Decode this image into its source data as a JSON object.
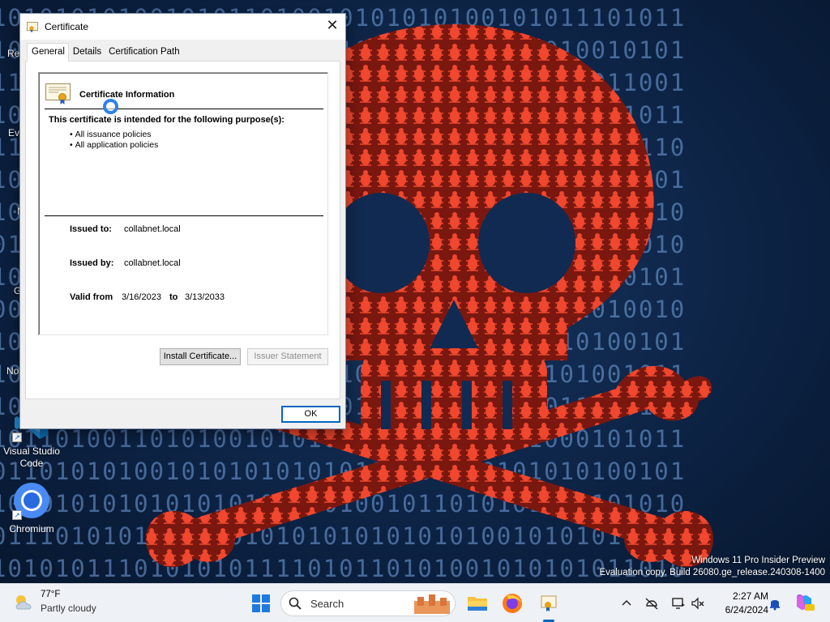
{
  "desktop": {
    "icons": [
      {
        "label": "Visual Studio\nCode"
      },
      {
        "label": "Chromium"
      }
    ],
    "partial_labels": [
      "Re",
      "Ev",
      "N",
      "G",
      "No"
    ],
    "watermark": {
      "line1": "Windows 11 Pro Insider Preview",
      "line2": "Evaluation copy. Build 26080.ge_release.240308-1400"
    }
  },
  "dialog": {
    "title": "Certificate",
    "close_glyph": "✕",
    "tabs": [
      {
        "label": "General",
        "active": true
      },
      {
        "label": "Details",
        "active": false
      },
      {
        "label": "Certification Path",
        "active": false
      }
    ],
    "info": {
      "heading": "Certificate Information",
      "purpose_heading": "This certificate is intended for the following purpose(s):",
      "purposes": [
        "All issuance policies",
        "All application policies"
      ],
      "issued_to_label": "Issued to:",
      "issued_to": "collabnet.local",
      "issued_by_label": "Issued by:",
      "issued_by": "collabnet.local",
      "valid_from_label": "Valid from",
      "valid_from": "3/16/2023",
      "valid_to_label": "to",
      "valid_to": "3/13/2033"
    },
    "buttons": {
      "install": "Install Certificate...",
      "issuer_statement": "Issuer Statement",
      "ok": "OK"
    }
  },
  "taskbar": {
    "weather": {
      "temp": "77°F",
      "condition": "Partly cloudy",
      "icon": "partly-cloudy-icon"
    },
    "search_placeholder": "Search",
    "pinned": [
      "windows-start-icon",
      "search-icon",
      "file-explorer-icon",
      "firefox-icon",
      "certificate-app-icon"
    ],
    "tray": [
      "chevron-up-icon",
      "network-off-icon",
      "display-icon",
      "volume-muted-icon"
    ],
    "clock": {
      "time": "2:27 AM",
      "date": "6/24/2024"
    },
    "notification_icon": "bell-icon",
    "copilot_icon": "copilot-icon"
  },
  "colors": {
    "wallpaper_blue": "#0d2446",
    "skull_red": "#e8432c",
    "accent": "#0067c0"
  }
}
